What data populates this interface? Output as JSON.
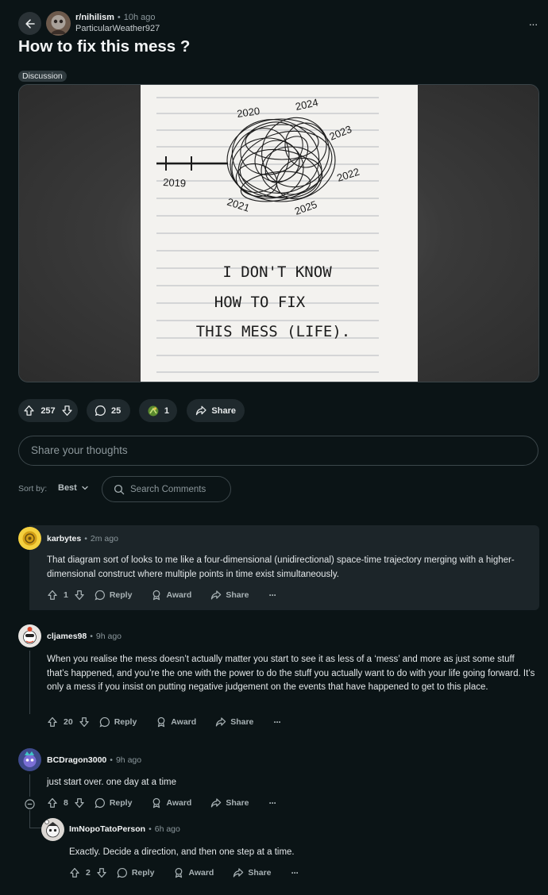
{
  "header": {
    "subreddit": "r/nihilism",
    "separator": "•",
    "time": "10h ago",
    "author": "ParticularWeather927",
    "more": "···"
  },
  "post": {
    "title": "How to fix this mess ?",
    "flair": "Discussion",
    "image": {
      "years": [
        "2020",
        "2024",
        "2023",
        "2022",
        "2025",
        "2021",
        "2019"
      ],
      "line1": "I DON'T KNOW",
      "line2": "HOW TO FIX",
      "line3": "THIS MESS (LIFE)."
    },
    "votes": "257",
    "comments": "25",
    "awards": "1",
    "share_label": "Share"
  },
  "composer": {
    "placeholder": "Share your thoughts"
  },
  "sort": {
    "label": "Sort by:",
    "value": "Best",
    "search_placeholder": "Search Comments"
  },
  "comments": [
    {
      "user": "karbytes",
      "time": "2m ago",
      "body": "That diagram sort of looks to me like a four-dimensional (unidirectional) space-time trajectory merging with a higher-dimensional construct where multiple points in time exist simultaneously.",
      "votes": "1"
    },
    {
      "user": "cljames98",
      "time": "9h ago",
      "body": "When you realise the mess doesn’t actually matter you start to see it as less of a ‘mess’ and more as just some stuff that’s happened, and you’re the one with the power to do the stuff you actually want to do with your life going forward. It’s only a mess if you insist on putting negative judgement on the events that have happened to get to this place.",
      "votes": "20"
    },
    {
      "user": "BCDragon3000",
      "time": "9h ago",
      "body": "just start over. one day at a time",
      "votes": "8"
    },
    {
      "user": "ImNopoTatoPerson",
      "time": "6h ago",
      "body": "Exactly. Decide a direction, and then one step at a time.",
      "votes": "2"
    }
  ],
  "actions": {
    "reply": "Reply",
    "award": "Award",
    "share": "Share",
    "more": "···",
    "sep": "•"
  },
  "colors": {
    "background": "#0b1416",
    "pill": "#1f292d",
    "text": "#d7dadc",
    "muted": "#8b979c"
  }
}
